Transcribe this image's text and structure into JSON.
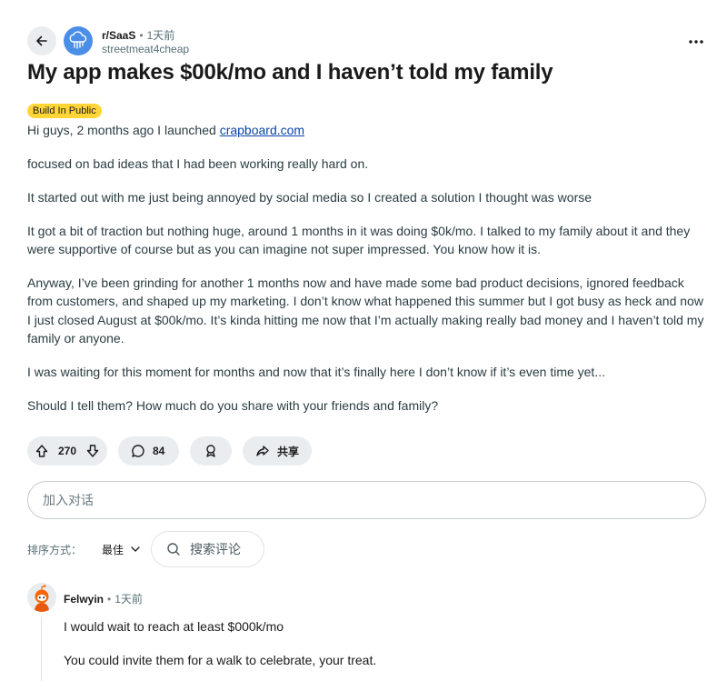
{
  "header": {
    "subreddit": "r/SaaS",
    "separator": "•",
    "time": "1天前",
    "author": "streetmeat4cheap"
  },
  "post": {
    "title": "My app makes $00k/mo and I haven’t told my family",
    "flair": "Build In Public",
    "intro_text": "Hi guys, 2 months ago I launched",
    "intro_link": "crapboard.com",
    "paragraphs": [
      "focused on bad ideas that I had been working really hard on.",
      "It started out with me just being annoyed by social media so I created a solution I thought was worse",
      "It got a bit of traction but nothing huge, around 1 months in it was doing $0k/mo. I talked to my family about it and they were supportive of course but as you can imagine not super impressed. You know how it is.",
      "Anyway, I’ve been grinding for another 1 months now and have made some bad product decisions, ignored feedback from customers, and shaped up my marketing. I don’t know what happened this summer but I got busy as heck and now I just closed August at $00k/mo. It’s kinda hitting me now that I’m actually making really bad money and I haven’t told my family or anyone.",
      "I was waiting for this moment for months and now that it’s finally here I don’t know if it’s even time yet...",
      "Should I tell them? How much do you share with your friends and family?"
    ]
  },
  "actions": {
    "votes": "270",
    "comments": "84",
    "share": "共享"
  },
  "comment_input": {
    "placeholder": "加入对话"
  },
  "sort": {
    "label": "排序方式：",
    "selected": "最佳",
    "search_label": "搜索评论"
  },
  "comments": [
    {
      "user": "Felwyin",
      "separator": "•",
      "time": "1天前",
      "lines": [
        "I would wait to reach at least $000k/mo",
        "You could invite them for a walk to celebrate, your treat."
      ]
    }
  ],
  "colors": {
    "flair_bg": "#ffd635",
    "pill_bg": "#eaedef",
    "link": "#0a45a6",
    "subreddit_avatar": "#4a8ee8"
  }
}
